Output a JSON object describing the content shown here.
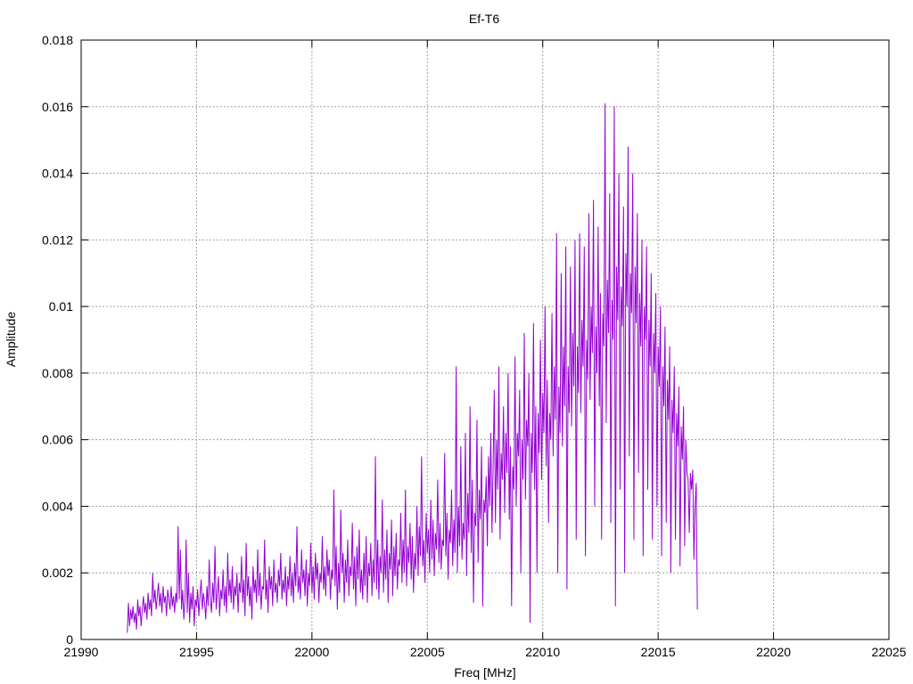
{
  "chart_data": {
    "type": "line",
    "title": "Ef-T6",
    "xlabel": "Freq [MHz]",
    "ylabel": "Amplitude",
    "xlim": [
      21990,
      22025
    ],
    "ylim": [
      0,
      0.018
    ],
    "xticks": [
      "21990",
      "21995",
      "22000",
      "22005",
      "22010",
      "22015",
      "22020",
      "22025"
    ],
    "yticks": [
      "0",
      "0.002",
      "0.004",
      "0.006",
      "0.008",
      "0.01",
      "0.012",
      "0.014",
      "0.016",
      "0.018"
    ],
    "grid": true,
    "legend": "none",
    "series": [
      {
        "color": "#9400d3",
        "x_start": 21992.0,
        "x_step": 0.05,
        "values": [
          0.0002,
          0.0011,
          0.0004,
          0.0009,
          0.0006,
          0.001,
          0.0005,
          0.0008,
          0.0003,
          0.0012,
          0.0007,
          0.001,
          0.0004,
          0.0009,
          0.0013,
          0.0008,
          0.0011,
          0.0006,
          0.0014,
          0.0009,
          0.0012,
          0.0007,
          0.002,
          0.0011,
          0.0015,
          0.0009,
          0.0013,
          0.0017,
          0.001,
          0.0014,
          0.0008,
          0.0016,
          0.0011,
          0.0013,
          0.0007,
          0.0015,
          0.0012,
          0.0009,
          0.0016,
          0.001,
          0.0013,
          0.0008,
          0.0014,
          0.0011,
          0.0034,
          0.0012,
          0.0027,
          0.0009,
          0.0015,
          0.0006,
          0.0012,
          0.003,
          0.0008,
          0.002,
          0.0005,
          0.0014,
          0.0009,
          0.0016,
          0.0004,
          0.0012,
          0.001,
          0.0015,
          0.0007,
          0.0013,
          0.0018,
          0.0009,
          0.0014,
          0.0011,
          0.0006,
          0.0016,
          0.001,
          0.0024,
          0.0012,
          0.0008,
          0.0017,
          0.0011,
          0.0028,
          0.0009,
          0.0014,
          0.0019,
          0.0007,
          0.0015,
          0.0012,
          0.0021,
          0.001,
          0.0016,
          0.0008,
          0.0026,
          0.0013,
          0.0018,
          0.0011,
          0.0022,
          0.0009,
          0.0016,
          0.0013,
          0.002,
          0.0008,
          0.0017,
          0.0014,
          0.0025,
          0.0011,
          0.0018,
          0.0007,
          0.0029,
          0.0013,
          0.0019,
          0.001,
          0.0016,
          0.0006,
          0.0022,
          0.0014,
          0.0018,
          0.0011,
          0.0027,
          0.0013,
          0.002,
          0.0009,
          0.0016,
          0.0015,
          0.003,
          0.0012,
          0.0018,
          0.0008,
          0.0022,
          0.0015,
          0.0019,
          0.001,
          0.0024,
          0.0014,
          0.0017,
          0.0011,
          0.0021,
          0.0016,
          0.0026,
          0.0012,
          0.0018,
          0.0014,
          0.0022,
          0.001,
          0.0019,
          0.0015,
          0.0025,
          0.0013,
          0.002,
          0.0011,
          0.0023,
          0.0016,
          0.0034,
          0.0014,
          0.0019,
          0.0012,
          0.0027,
          0.0017,
          0.0021,
          0.0013,
          0.0024,
          0.001,
          0.002,
          0.0016,
          0.0029,
          0.0014,
          0.0022,
          0.0012,
          0.0026,
          0.0018,
          0.0023,
          0.0011,
          0.002,
          0.0017,
          0.0031,
          0.0015,
          0.0022,
          0.0013,
          0.0027,
          0.0019,
          0.0024,
          0.0012,
          0.0021,
          0.0018,
          0.0045,
          0.0016,
          0.0028,
          0.0009,
          0.0023,
          0.0014,
          0.0039,
          0.002,
          0.0026,
          0.0011,
          0.0024,
          0.0017,
          0.003,
          0.0013,
          0.0022,
          0.0019,
          0.0035,
          0.0015,
          0.0025,
          0.001,
          0.0028,
          0.0018,
          0.0033,
          0.0014,
          0.0021,
          0.0012,
          0.0026,
          0.0016,
          0.0031,
          0.0011,
          0.0023,
          0.0019,
          0.0029,
          0.0013,
          0.0024,
          0.0017,
          0.0055,
          0.0015,
          0.003,
          0.0012,
          0.0025,
          0.002,
          0.0042,
          0.0014,
          0.0027,
          0.0018,
          0.0033,
          0.0011,
          0.0026,
          0.0021,
          0.0036,
          0.0013,
          0.0028,
          0.0019,
          0.0032,
          0.0015,
          0.0024,
          0.0022,
          0.0038,
          0.0017,
          0.003,
          0.002,
          0.0045,
          0.0016,
          0.0028,
          0.0023,
          0.0035,
          0.0018,
          0.0031,
          0.0014,
          0.0026,
          0.0021,
          0.004,
          0.0019,
          0.0034,
          0.0025,
          0.0055,
          0.0022,
          0.003,
          0.0017,
          0.0038,
          0.0026,
          0.0033,
          0.002,
          0.0042,
          0.0024,
          0.0036,
          0.0019,
          0.0032,
          0.0027,
          0.0048,
          0.0023,
          0.0035,
          0.0021,
          0.003,
          0.0028,
          0.0056,
          0.0025,
          0.0038,
          0.0018,
          0.0033,
          0.0029,
          0.0045,
          0.0022,
          0.0036,
          0.0026,
          0.0082,
          0.002,
          0.004,
          0.0028,
          0.0058,
          0.0024,
          0.0035,
          0.003,
          0.0062,
          0.0019,
          0.0044,
          0.0032,
          0.007,
          0.0026,
          0.0048,
          0.0011,
          0.0038,
          0.0034,
          0.0066,
          0.0023,
          0.0045,
          0.0036,
          0.0058,
          0.001,
          0.0042,
          0.0038,
          0.0049,
          0.0028,
          0.0055,
          0.004,
          0.0062,
          0.0032,
          0.0052,
          0.0075,
          0.0035,
          0.006,
          0.0045,
          0.0082,
          0.003,
          0.0056,
          0.0048,
          0.007,
          0.0038,
          0.0062,
          0.005,
          0.008,
          0.0036,
          0.0058,
          0.001,
          0.0052,
          0.0045,
          0.0085,
          0.004,
          0.0062,
          0.0055,
          0.0075,
          0.002,
          0.006,
          0.0048,
          0.0092,
          0.0042,
          0.0066,
          0.0058,
          0.008,
          0.0005,
          0.0062,
          0.005,
          0.0095,
          0.0045,
          0.007,
          0.002,
          0.0068,
          0.0056,
          0.009,
          0.0048,
          0.0074,
          0.0062,
          0.01,
          0.0052,
          0.0078,
          0.0035,
          0.0068,
          0.006,
          0.0098,
          0.0055,
          0.0082,
          0.0066,
          0.0122,
          0.002,
          0.0076,
          0.0062,
          0.011,
          0.0058,
          0.0088,
          0.007,
          0.0118,
          0.0015,
          0.0082,
          0.0068,
          0.0112,
          0.0064,
          0.0092,
          0.0076,
          0.012,
          0.003,
          0.0088,
          0.0074,
          0.0122,
          0.0068,
          0.0096,
          0.0082,
          0.0118,
          0.0025,
          0.009,
          0.0078,
          0.0128,
          0.0072,
          0.01,
          0.0086,
          0.0132,
          0.004,
          0.0094,
          0.008,
          0.0124,
          0.007,
          0.0104,
          0.003,
          0.0098,
          0.0088,
          0.0161,
          0.0065,
          0.0108,
          0.0092,
          0.0134,
          0.0035,
          0.0102,
          0.009,
          0.016,
          0.001,
          0.0112,
          0.0096,
          0.014,
          0.0045,
          0.0106,
          0.0094,
          0.013,
          0.002,
          0.0116,
          0.01,
          0.0148,
          0.0055,
          0.011,
          0.0098,
          0.014,
          0.003,
          0.0112,
          0.0095,
          0.0128,
          0.005,
          0.0104,
          0.0088,
          0.012,
          0.0025,
          0.01,
          0.009,
          0.0118,
          0.0045,
          0.0096,
          0.0082,
          0.011,
          0.003,
          0.0092,
          0.008,
          0.0104,
          0.004,
          0.0088,
          0.0076,
          0.01,
          0.0025,
          0.0082,
          0.007,
          0.0094,
          0.0035,
          0.0078,
          0.0066,
          0.0088,
          0.002,
          0.0072,
          0.0062,
          0.0082,
          0.003,
          0.0068,
          0.0058,
          0.0076,
          0.0022,
          0.0064,
          0.0054,
          0.007,
          0.0028,
          0.006,
          0.005,
          0.0048,
          0.0032,
          0.005,
          0.0045,
          0.0051,
          0.0024,
          0.004,
          0.0047,
          0.0009
        ]
      }
    ]
  }
}
